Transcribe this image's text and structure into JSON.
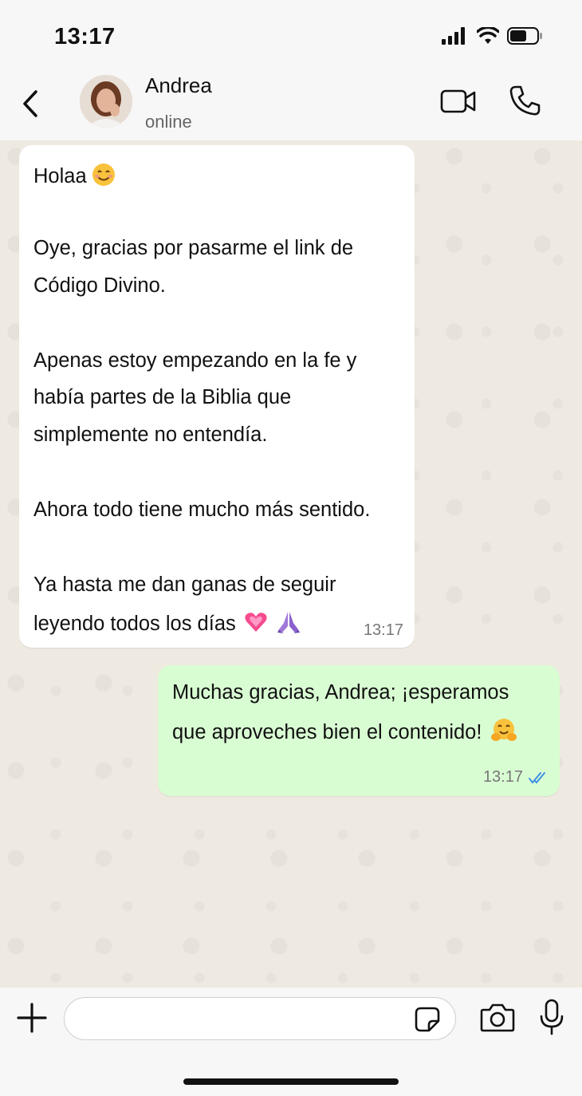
{
  "status_bar": {
    "time": "13:17",
    "icons": [
      "cellular-signal-icon",
      "wifi-icon",
      "battery-icon"
    ]
  },
  "header": {
    "contact_name": "Andrea",
    "contact_status": "online",
    "icons": [
      "back-chevron-icon",
      "avatar",
      "video-camera-icon",
      "phone-icon"
    ]
  },
  "messages": [
    {
      "direction": "incoming",
      "lines": [
        "Holaa",
        "",
        "Oye, gracias por pasarme el link de",
        "Código Divino.",
        "",
        "Apenas estoy empezando en la fe y",
        "había partes de la Biblia que",
        "simplemente no entendía.",
        "",
        "Ahora todo tiene mucho más sentido.",
        "",
        "Ya hasta me dan ganas de seguir",
        "leyendo todos los días"
      ],
      "emojis": [
        "smiling-face-icon",
        "sparkling-heart-icon",
        "folded-hands-icon"
      ],
      "time": "13:17"
    },
    {
      "direction": "outgoing",
      "lines": [
        "Muchas gracias, Andrea; ¡esperamos",
        "que aproveches bien el contenido!"
      ],
      "emojis": [
        "hugging-face-icon"
      ],
      "time": "13:17",
      "read_receipt": "double-check-icon"
    }
  ],
  "composer": {
    "input_value": "",
    "icons": [
      "plus-icon",
      "sticker-icon",
      "camera-icon",
      "microphone-icon"
    ]
  },
  "colors": {
    "incoming_bubble": "#ffffff",
    "outgoing_bubble": "#d9fdd3",
    "chat_background": "#efeae1",
    "read_receipt": "#3d8fe3"
  }
}
